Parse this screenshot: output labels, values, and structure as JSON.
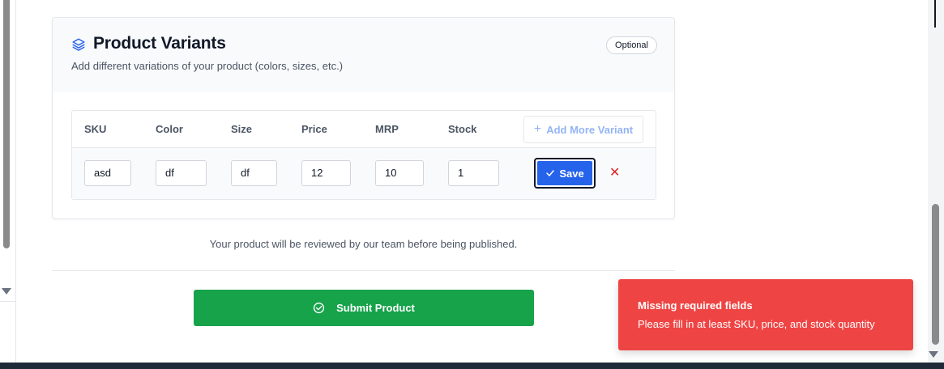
{
  "variants_section": {
    "title": "Product Variants",
    "subtitle": "Add different variations of your product (colors, sizes, etc.)",
    "badge": "Optional",
    "icon": "layers-icon",
    "columns": [
      "SKU",
      "Color",
      "Size",
      "Price",
      "MRP",
      "Stock"
    ],
    "add_button_label": "Add More Variant",
    "row": {
      "sku": "asd",
      "color": "df",
      "size": "df",
      "price": "12",
      "mrp": "10",
      "stock": "1"
    },
    "save_label": "Save",
    "remove_icon": "close-icon"
  },
  "review_note": "Your product will be reviewed by our team before being published.",
  "submit_label": "Submit Product",
  "toast": {
    "title": "Missing required fields",
    "message": "Please fill in at least SKU, price, and stock quantity"
  },
  "colors": {
    "primary": "#2563eb",
    "success": "#16a34a",
    "error": "#ef4444"
  }
}
